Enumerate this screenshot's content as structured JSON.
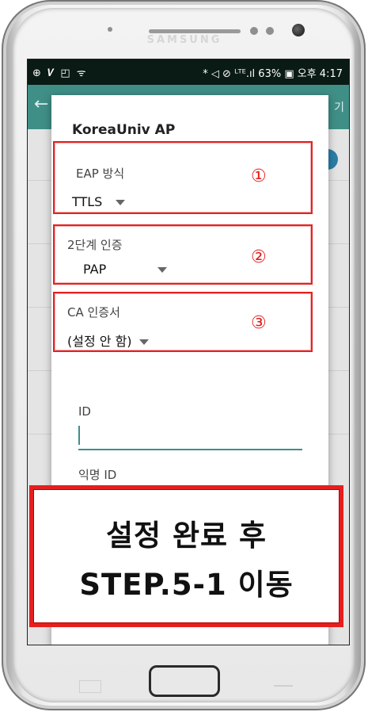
{
  "device": {
    "brand": "SAMSUNG"
  },
  "status_bar": {
    "left_icons": "⊕ 𝑽 ◰ ᯤ",
    "right_text": "* ◁ ⊘ ᴸᵀᴱ.ıl 63% ▣ 오후 4:17"
  },
  "app_bar": {
    "back_icon": "arrow-left-icon",
    "right_text": "기"
  },
  "dialog": {
    "title": "KoreaUniv AP",
    "fields": [
      {
        "label": "EAP 방식",
        "value": "TTLS",
        "number": "①"
      },
      {
        "label": "2단계 인증",
        "value": "PAP",
        "number": "②"
      },
      {
        "label": "CA 인증서",
        "value": "(설정 안 함)",
        "number": "③"
      }
    ],
    "id_label": "ID",
    "anon_id_label": "익명 ID"
  },
  "overlay": {
    "line1": "설정 완료 후",
    "line2": "STEP.5-1 이동"
  },
  "colors": {
    "highlight": "#e32222",
    "accent": "#3f8f87",
    "toggle": "#2c7ea8"
  }
}
